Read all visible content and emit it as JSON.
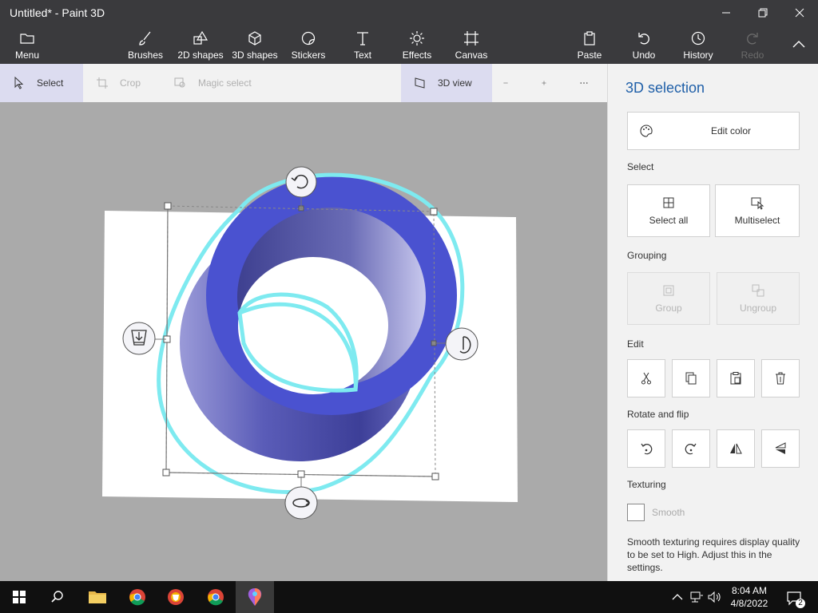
{
  "window": {
    "title": "Untitled* - Paint 3D"
  },
  "ribbon": {
    "menu": "Menu",
    "brushes": "Brushes",
    "shapes2d": "2D shapes",
    "shapes3d": "3D shapes",
    "stickers": "Stickers",
    "text": "Text",
    "effects": "Effects",
    "canvas": "Canvas",
    "paste": "Paste",
    "undo": "Undo",
    "history": "History",
    "redo": "Redo"
  },
  "toolbar": {
    "select": "Select",
    "crop": "Crop",
    "magic_select": "Magic select",
    "view_3d": "3D view"
  },
  "panel": {
    "title": "3D selection",
    "edit_color": "Edit color",
    "select_label": "Select",
    "select_all": "Select all",
    "multiselect": "Multiselect",
    "grouping_label": "Grouping",
    "group": "Group",
    "ungroup": "Ungroup",
    "edit_label": "Edit",
    "rotate_label": "Rotate and flip",
    "texturing_label": "Texturing",
    "smooth": "Smooth",
    "note": "Smooth texturing requires display quality to be set to High. Adjust this in the settings."
  },
  "taskbar": {
    "time": "8:04 AM",
    "date": "4/8/2022",
    "notifications": "2"
  },
  "colors": {
    "object_fill": "#4a52d0",
    "selection_outline": "#7eeaf0",
    "accent": "#1f5fa8"
  }
}
